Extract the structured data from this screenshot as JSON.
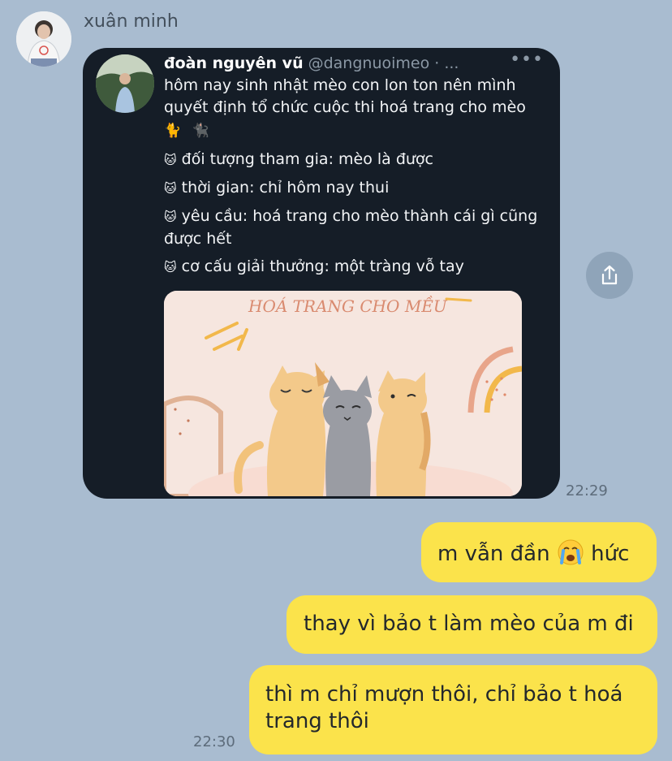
{
  "sender": {
    "name": "xuân minh"
  },
  "tweet": {
    "display_name": "đoàn nguyên vũ",
    "handle": "@dangnuoimeo · ...",
    "menu": "•••",
    "intro": "hôm nay sinh nhật mèo con lon ton nên mình quyết định tổ chức cuộc thi hoá trang cho mèo",
    "intro_emojis": "🐈 🐈‍⬛",
    "bullet_emoji": "🐱",
    "items": [
      "đối tượng tham gia: mèo là được",
      "thời gian: chỉ hôm nay thui",
      "yêu cầu: hoá trang cho mèo thành cái gì cũng được hết",
      "cơ cấu giải thưởng: một tràng vỗ tay"
    ],
    "image_caption": "HOÁ TRANG CHO MỀU"
  },
  "share": {
    "icon": "share-icon"
  },
  "timestamps": {
    "received": "22:29",
    "sent": "22:30"
  },
  "messages": [
    {
      "before": "m vẫn đần ",
      "emoji": "crying-face-emoji",
      "after": " hức"
    },
    {
      "text": "thay vì bảo t làm mèo của m đi"
    },
    {
      "text": "thì m chỉ mượn thôi, chỉ bảo t hoá trang thôi"
    }
  ],
  "colors": {
    "background": "#a9bcd0",
    "tweet_card": "#151d27",
    "bubble_sent": "#fbe34b",
    "share_button": "#8fa4b9"
  }
}
